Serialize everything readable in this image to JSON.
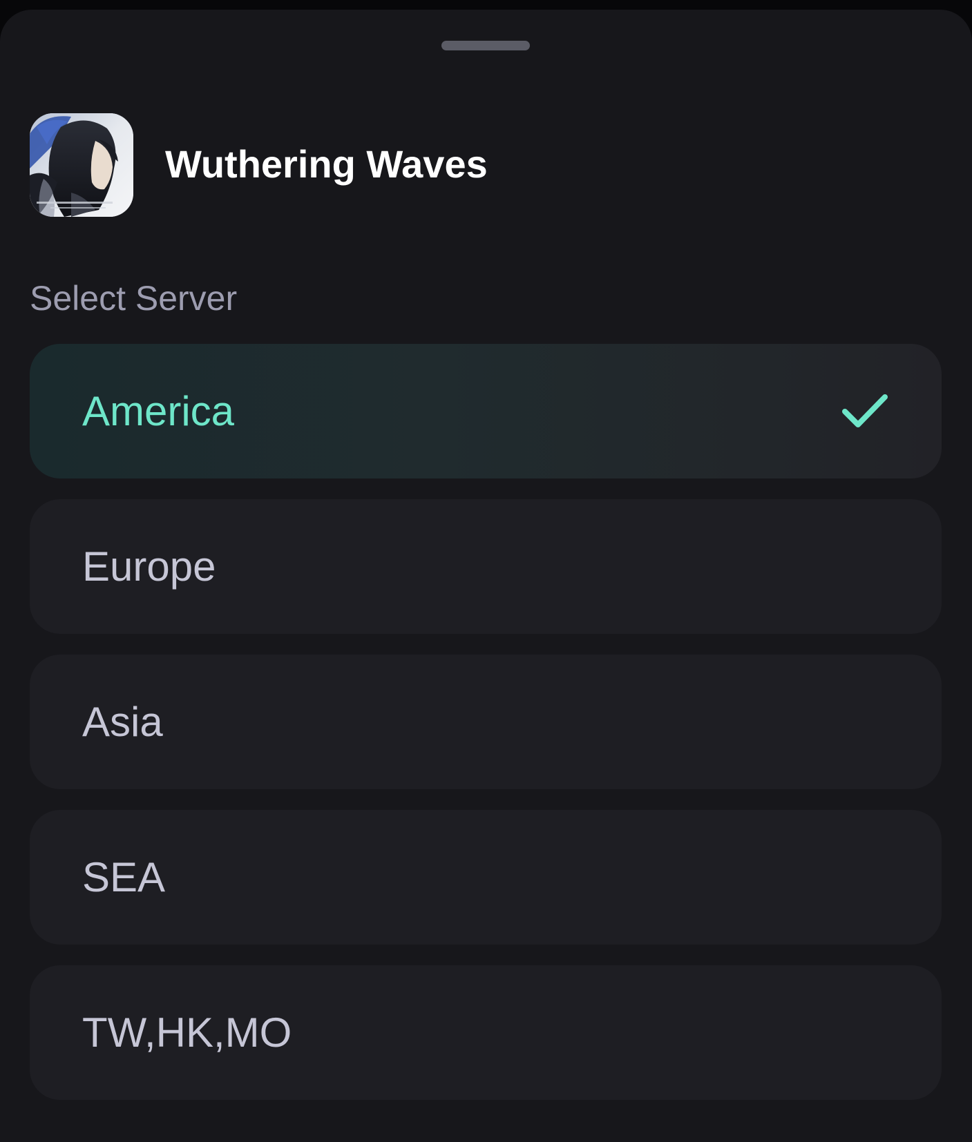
{
  "header": {
    "app_icon": "app-icon-character-portrait",
    "app_title": "Wuthering Waves"
  },
  "section": {
    "label": "Select Server"
  },
  "servers": [
    {
      "label": "America",
      "selected": true
    },
    {
      "label": "Europe",
      "selected": false
    },
    {
      "label": "Asia",
      "selected": false
    },
    {
      "label": "SEA",
      "selected": false
    },
    {
      "label": "TW,HK,MO",
      "selected": false
    }
  ],
  "icons": {
    "selected_indicator": "check-icon"
  },
  "colors": {
    "background": "#17171b",
    "item_background": "#1e1e23",
    "accent": "#6ee6c9",
    "label": "#9d9db0",
    "item_text": "#c6c6d6"
  }
}
